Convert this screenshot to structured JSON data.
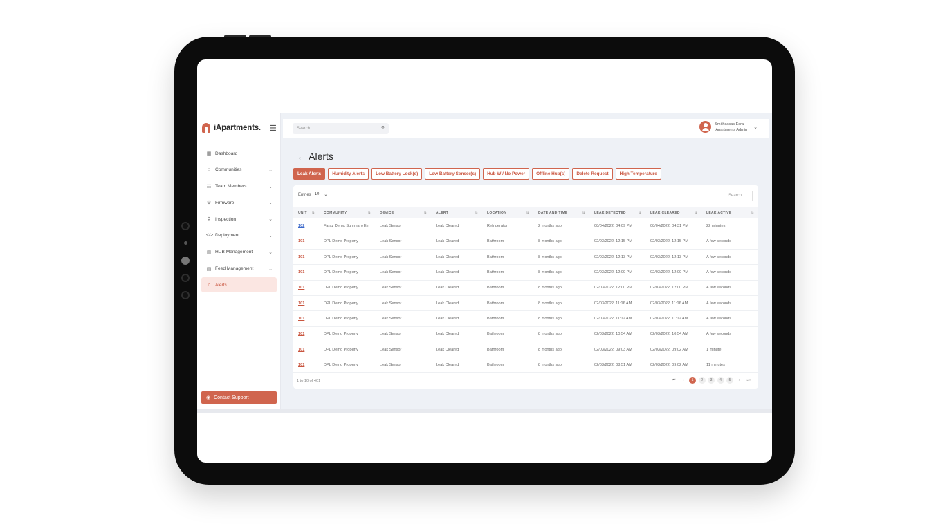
{
  "app": {
    "brand": "iApartments.",
    "search_placeholder": "Search",
    "user": {
      "name": "Smithsasas Esra",
      "role": "iApartments Admin"
    }
  },
  "sidebar": {
    "items": [
      {
        "label": "Dashboard",
        "icon": "dashboard-icon"
      },
      {
        "label": "Communities",
        "icon": "home-icon"
      },
      {
        "label": "Team Members",
        "icon": "team-icon"
      },
      {
        "label": "Firmware",
        "icon": "gear-icon"
      },
      {
        "label": "Inspection",
        "icon": "search-icon"
      },
      {
        "label": "Deployment",
        "icon": "code-icon"
      },
      {
        "label": "HUB Management",
        "icon": "hub-icon"
      },
      {
        "label": "Feed Management",
        "icon": "document-icon"
      },
      {
        "label": "Alerts",
        "icon": "bell-icon"
      }
    ],
    "contact": "Contact Support"
  },
  "page": {
    "back": "←",
    "title": "Alerts"
  },
  "tabs": [
    "Leak Alerts",
    "Humidity Alerts",
    "Low Battery Lock(s)",
    "Low Battery Sensor(s)",
    "Hub W / No Power",
    "Offline Hub(s)",
    "Delete Request",
    "High Temperature"
  ],
  "table": {
    "entries_label": "Entries",
    "entries_value": "10",
    "search_placeholder": "Search",
    "columns": [
      "UNIT",
      "COMMUNITY",
      "DEVICE",
      "ALERT",
      "LOCATION",
      "DATE AND TIME",
      "LEAK DETECTED",
      "LEAK CLEARED",
      "LEAK ACTIVE"
    ],
    "rows": [
      [
        "102",
        "Faraz Demo Summary Em",
        "Leak Sensor",
        "Leak Cleared",
        "Refrigerator",
        "2 months ago",
        "08/04/2022, 04:09 PM",
        "08/04/2022, 04:31 PM",
        "22 minutes"
      ],
      [
        "101",
        "DPL Demo Property",
        "Leak Sensor",
        "Leak Cleared",
        "Bathroom",
        "8 months ago",
        "02/03/2022, 12:15 PM",
        "02/03/2022, 12:15 PM",
        "A few seconds"
      ],
      [
        "101",
        "DPL Demo Property",
        "Leak Sensor",
        "Leak Cleared",
        "Bathroom",
        "8 months ago",
        "02/03/2022, 12:13 PM",
        "02/03/2022, 12:13 PM",
        "A few seconds"
      ],
      [
        "101",
        "DPL Demo Property",
        "Leak Sensor",
        "Leak Cleared",
        "Bathroom",
        "8 months ago",
        "02/03/2022, 12:09 PM",
        "02/03/2022, 12:09 PM",
        "A few seconds"
      ],
      [
        "101",
        "DPL Demo Property",
        "Leak Sensor",
        "Leak Cleared",
        "Bathroom",
        "8 months ago",
        "02/03/2022, 12:00 PM",
        "02/03/2022, 12:00 PM",
        "A few seconds"
      ],
      [
        "101",
        "DPL Demo Property",
        "Leak Sensor",
        "Leak Cleared",
        "Bathroom",
        "8 months ago",
        "02/03/2022, 11:16 AM",
        "02/03/2022, 11:16 AM",
        "A few seconds"
      ],
      [
        "101",
        "DPL Demo Property",
        "Leak Sensor",
        "Leak Cleared",
        "Bathroom",
        "8 months ago",
        "02/03/2022, 11:12 AM",
        "02/03/2022, 11:12 AM",
        "A few seconds"
      ],
      [
        "101",
        "DPL Demo Property",
        "Leak Sensor",
        "Leak Cleared",
        "Bathroom",
        "8 months ago",
        "02/03/2022, 10:54 AM",
        "02/03/2022, 10:54 AM",
        "A few seconds"
      ],
      [
        "101",
        "DPL Demo Property",
        "Leak Sensor",
        "Leak Cleared",
        "Bathroom",
        "8 months ago",
        "02/03/2022, 09:03 AM",
        "02/03/2022, 09:02 AM",
        "1 minute"
      ],
      [
        "101",
        "DPL Demo Property",
        "Leak Sensor",
        "Leak Cleared",
        "Bathroom",
        "8 months ago",
        "02/03/2022, 08:51 AM",
        "02/03/2022, 09:02 AM",
        "11 minutes"
      ]
    ],
    "footer": "1 to 10 of 401",
    "pages": [
      "1",
      "2",
      "3",
      "4",
      "5"
    ],
    "current_page": "1"
  },
  "colors": {
    "accent": "#d0654e",
    "link_blue": "#3a67c9"
  }
}
